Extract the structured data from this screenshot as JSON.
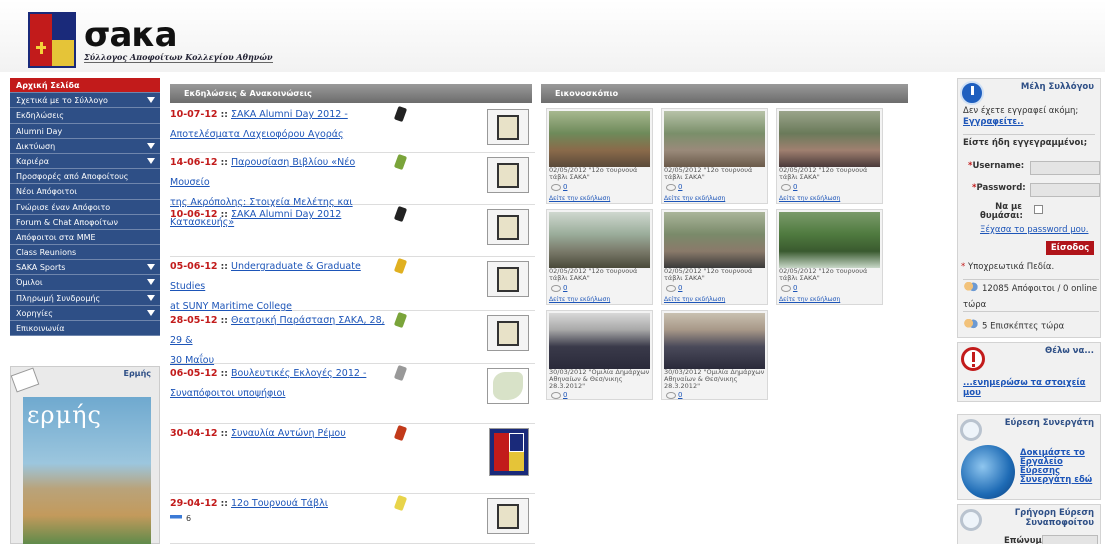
{
  "header": {
    "logo_text": "σaκa",
    "subtitle": "Σύλλογος Αποφοίτων Κολλεγίου Αθηνών"
  },
  "sidebar": {
    "items": [
      {
        "label": "Αρχική Σελίδα",
        "active": true,
        "arrow": false
      },
      {
        "label": "Σχετικά με το Σύλλογο",
        "active": false,
        "arrow": true
      },
      {
        "label": "Εκδηλώσεις",
        "active": false,
        "arrow": false
      },
      {
        "label": "Alumni Day",
        "active": false,
        "arrow": false
      },
      {
        "label": "Δικτύωση",
        "active": false,
        "arrow": true
      },
      {
        "label": "Καριέρα",
        "active": false,
        "arrow": true
      },
      {
        "label": "Προσφορές από Αποφοίτους",
        "active": false,
        "arrow": false
      },
      {
        "label": "Νέοι Απόφοιτοι",
        "active": false,
        "arrow": false
      },
      {
        "label": "Γνώρισε έναν Απόφοιτο",
        "active": false,
        "arrow": false
      },
      {
        "label": "Forum & Chat Αποφοίτων",
        "active": false,
        "arrow": false
      },
      {
        "label": "Απόφοιτοι στα ΜΜΕ",
        "active": false,
        "arrow": false
      },
      {
        "label": "Class Reunions",
        "active": false,
        "arrow": false
      },
      {
        "label": "SAKA Sports",
        "active": false,
        "arrow": true
      },
      {
        "label": "Όμιλοι",
        "active": false,
        "arrow": true
      },
      {
        "label": "Πληρωμή Συνδρομής",
        "active": false,
        "arrow": true
      },
      {
        "label": "Χορηγίες",
        "active": false,
        "arrow": true
      },
      {
        "label": "Επικοινωνία",
        "active": false,
        "arrow": false
      }
    ],
    "ermis_title": "Ερμής",
    "ermis_cover": "ερμής"
  },
  "events": {
    "heading": "Εκδηλώσεις & Ανακοινώσεις",
    "sep": " :: ",
    "items": [
      {
        "date": "10-07-12",
        "title_line1": "ΣΑΚΑ Alumni Day 2012 -",
        "title_line2": "Αποτελέσματα Λαχειοφόρου Αγοράς",
        "icon": "microphone-icon"
      },
      {
        "date": "14-06-12",
        "title_line1": "Παρουσίαση Βιβλίου «Νέο Μουσείο",
        "title_line2": "της Ακρόπολης: Στοιχεία Μελέτης και Κατασκευής»",
        "icon": "palette-icon"
      },
      {
        "date": "10-06-12",
        "title_line1": "ΣΑΚΑ Alumni Day 2012",
        "title_line2": "",
        "icon": "microphone-icon"
      },
      {
        "date": "05-06-12",
        "title_line1": "Undergraduate & Graduate Studies",
        "title_line2": "at SUNY Maritime College",
        "icon": "folder-icon"
      },
      {
        "date": "28-05-12",
        "title_line1": "Θεατρική Παράσταση ΣΑΚΑ, 28, 29 &",
        "title_line2": "30 Μαΐου",
        "icon": "palette-icon"
      },
      {
        "date": "06-05-12",
        "title_line1": "Βουλευτικές Εκλογές 2012 -",
        "title_line2": "Συναπόφοιτοι υποψήφιοι",
        "icon": "ballot-icon"
      },
      {
        "date": "30-04-12",
        "title_line1": "Συναυλία Αντώνη Ρέμου",
        "title_line2": "",
        "icon": "music-icon"
      },
      {
        "date": "29-04-12",
        "title_line1": "12ο Τουρνουά Τάβλι",
        "title_line2": "",
        "icon": "trophy-icon",
        "count": "6"
      }
    ]
  },
  "gallery": {
    "heading": "Εικονοσκόπιο",
    "link_text": "Δείτε την εκδήλωση",
    "cells": [
      {
        "caption": "02/05/2012 \"12ο τουρνουά τάβλι ΣΑΚΑ\"",
        "comments": "0",
        "link": true
      },
      {
        "caption": "02/05/2012 \"12ο τουρνουά τάβλι ΣΑΚΑ\"",
        "comments": "0",
        "link": true
      },
      {
        "caption": "02/05/2012 \"12ο τουρνουά τάβλι ΣΑΚΑ\"",
        "comments": "0",
        "link": true
      },
      {
        "caption": "02/05/2012 \"12ο τουρνουά τάβλι ΣΑΚΑ\"",
        "comments": "0",
        "link": true
      },
      {
        "caption": "02/05/2012 \"12ο τουρνουά τάβλι ΣΑΚΑ\"",
        "comments": "0",
        "link": true
      },
      {
        "caption": "02/05/2012 \"12ο τουρνουά τάβλι ΣΑΚΑ\"",
        "comments": "0",
        "link": true
      },
      {
        "caption": "30/03/2012 \"Ομιλία Δημάρχων Αθηναίων & Θεσ/νικης 28.3.2012\"",
        "comments": "0",
        "link": false
      },
      {
        "caption": "30/03/2012 \"Ομιλία Δημάρχων Αθηναίων & Θεσ/νικης 28.3.2012\"",
        "comments": "0",
        "link": false
      }
    ]
  },
  "members": {
    "title": "Μέλη Συλλόγου",
    "not_registered": "Δεν έχετε εγγραφεί ακόμη;",
    "register_link": "Εγγραφείτε..",
    "already": "Είστε ήδη εγγεγραμμένοι;",
    "username_label": "*Username:",
    "password_label": "*Password:",
    "remember_label": "Να με θυμάσαι:",
    "forgot_link": "Ξέχασα το password μου.",
    "login_button": "Είσοδος",
    "required_note": "* Υποχρεωτικά Πεδία.",
    "online_alumni": "12085 Απόφοιτοι / 0 online τώρα",
    "visitors": "5 Επισκέπτες τώρα"
  },
  "want_to": {
    "title": "Θέλω να...",
    "link": "...ενημερώσω τα στοιχεία μου"
  },
  "partner": {
    "title": "Εύρεση Συνεργάτη",
    "link": "Δοκιμάστε το Εργαλείο Εύρεσης Συνεργάτη εδώ"
  },
  "quick": {
    "title": "Γρήγορη Εύρεση Συναποφοίτου",
    "surname_label": "Επώνυμο:"
  }
}
